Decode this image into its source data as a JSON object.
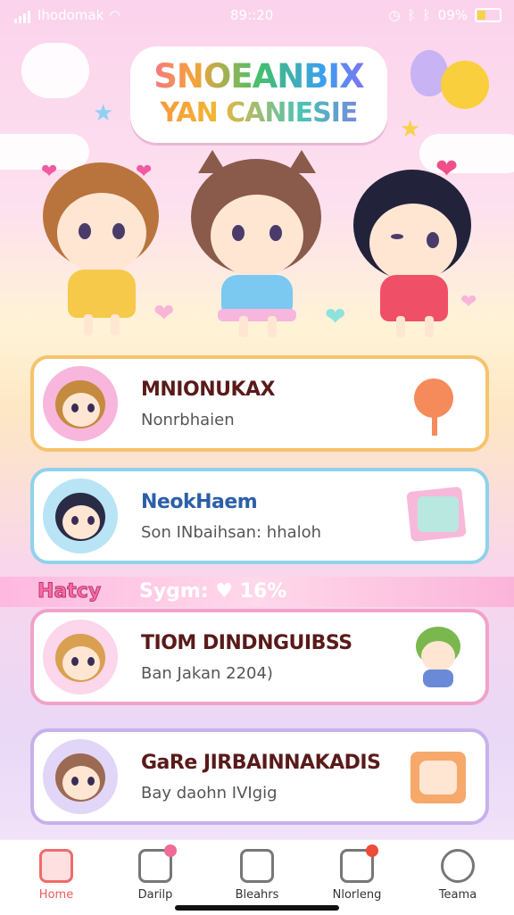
{
  "status_bar": {
    "carrier": "Ihodomak",
    "time": "89::20",
    "battery": "09%"
  },
  "title": {
    "line1": "SNOEANBIX",
    "line2": "YAN CANIESIE"
  },
  "cards": [
    {
      "title": "MNIONUKAX",
      "subtitle": "Nonrbhaien",
      "border": "#f5c36c",
      "title_color": "#5a1a1a"
    },
    {
      "title": "NeokHaem",
      "subtitle": "Son INbaihsan: hhaloh",
      "border": "#8fd2ec",
      "title_color": "#2c5fa8"
    },
    {
      "title": "TIOM DINDNGUIBSS",
      "subtitle": "Ban Jakan 2204)",
      "border": "#f1a2c8",
      "title_color": "#5a1a1a"
    },
    {
      "title": "GaRe JIRBAINNAKADIS",
      "subtitle": "Bay daohn IVIgig",
      "border": "#c6b1ec",
      "title_color": "#5a1a1a"
    }
  ],
  "banner": {
    "left": "Hatcy",
    "right": "Sygm: ♥ 16%"
  },
  "nav": [
    {
      "label": "Home",
      "icon": "home-icon",
      "active": true
    },
    {
      "label": "Darilp",
      "icon": "daily-icon",
      "active": false
    },
    {
      "label": "Bleahrs",
      "icon": "boards-icon",
      "active": false
    },
    {
      "label": "Nlorleng",
      "icon": "message-icon",
      "active": false
    },
    {
      "label": "Teama",
      "icon": "profile-icon",
      "active": false
    }
  ],
  "colors": {
    "accent": "#ef5a5a",
    "pink": "#f25fa7"
  }
}
